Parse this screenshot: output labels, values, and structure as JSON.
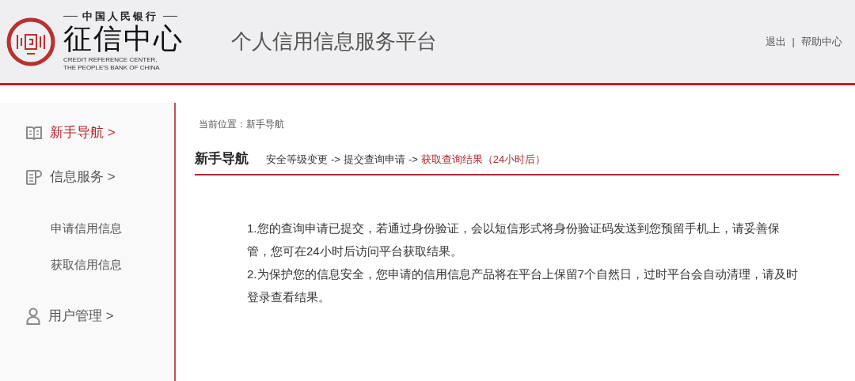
{
  "header": {
    "logo": {
      "bank": "中国人民银行",
      "name": "征信中心",
      "english": [
        "CREDIT REFERENCE CENTER,",
        "THE PEOPLE'S BANK OF CHINA"
      ]
    },
    "title": "个人信用信息服务平台",
    "links": [
      {
        "label": "退出"
      },
      {
        "label": "帮助中心"
      }
    ],
    "separator": "|"
  },
  "sidebar": {
    "items": [
      {
        "label": "新手导航 >",
        "kind": "book",
        "selected": true
      },
      {
        "label": "信息服务 >",
        "kind": "doc",
        "selected": false,
        "children": [
          {
            "label": "申请信用信息",
            "selected": false
          },
          {
            "label": "获取信用信息",
            "selected": false
          }
        ]
      },
      {
        "label": "用户管理 >",
        "kind": "user",
        "selected": false
      }
    ]
  },
  "breadcrumb": "当前位置：新手导航",
  "section": {
    "title": "新手导航",
    "arrows": [
      "->",
      "->"
    ],
    "steps": [
      {
        "label": "安全等级变更",
        "selected": false
      },
      {
        "label": "提交查询申请",
        "selected": false
      },
      {
        "label": "获取查询结果（24小时后）",
        "selected": true
      }
    ]
  },
  "notes": [
    "1.您的查询申请已提交，若通过身份验证，会以短信形式将身份验证码发送到您预留手机上，请妥善保管，您可在24小时后访问平台获取结果。",
    "2.为保护您的信息安全，您申请的信用信息产品将在平台上保留7个自然日，过时平台会自动清理，请及时登录查看结果。"
  ]
}
